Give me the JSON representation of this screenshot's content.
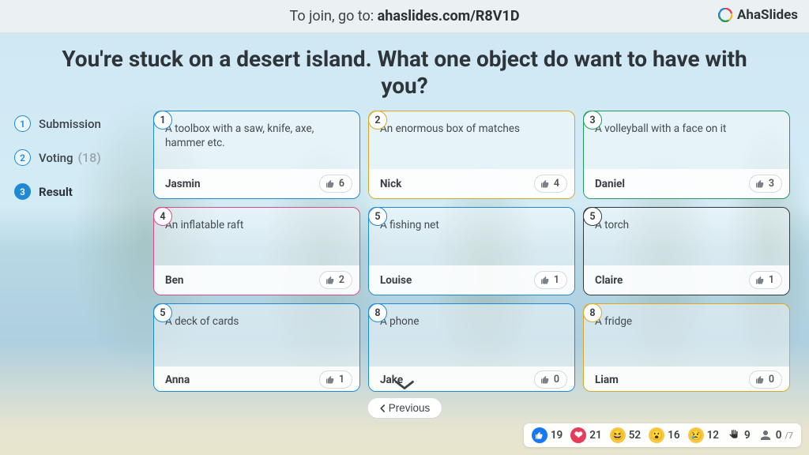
{
  "topbar": {
    "prefix": "To join, go to: ",
    "url": "ahaslides.com/R8V1D"
  },
  "brand": "AhaSlides",
  "question": "You're stuck on a desert island. What one object do want to have with you?",
  "sidebar": {
    "items": [
      {
        "num": "1",
        "label": "Submission",
        "count": ""
      },
      {
        "num": "2",
        "label": "Voting",
        "count": "(18)"
      },
      {
        "num": "3",
        "label": "Result",
        "count": ""
      }
    ]
  },
  "cards": [
    {
      "rank": "1",
      "answer": "A toolbox with a saw, knife, axe, hammer etc.",
      "name": "Jasmin",
      "votes": "6",
      "color": "#2089d6"
    },
    {
      "rank": "2",
      "answer": "An enormous box of matches",
      "name": "Nick",
      "votes": "4",
      "color": "#d9a828"
    },
    {
      "rank": "3",
      "answer": "A volleyball with a face on it",
      "name": "Daniel",
      "votes": "3",
      "color": "#1f9c5a"
    },
    {
      "rank": "4",
      "answer": "An inflatable raft",
      "name": "Ben",
      "votes": "2",
      "color": "#d94c88"
    },
    {
      "rank": "5",
      "answer": "A fishing net",
      "name": "Louise",
      "votes": "1",
      "color": "#2089d6"
    },
    {
      "rank": "5",
      "answer": "A torch",
      "name": "Claire",
      "votes": "1",
      "color": "#34393e"
    },
    {
      "rank": "5",
      "answer": "A deck of cards",
      "name": "Anna",
      "votes": "1",
      "color": "#2089d6"
    },
    {
      "rank": "8",
      "answer": "A phone",
      "name": "Jake",
      "votes": "0",
      "color": "#2089d6"
    },
    {
      "rank": "8",
      "answer": "A fridge",
      "name": "Liam",
      "votes": "0",
      "color": "#d9a828"
    }
  ],
  "prev_label": "Previous",
  "reactions": {
    "like": "19",
    "heart": "21",
    "laugh": "52",
    "wow": "16",
    "sad": "12",
    "hand": "9",
    "people_current": "0",
    "people_total": "/7"
  }
}
